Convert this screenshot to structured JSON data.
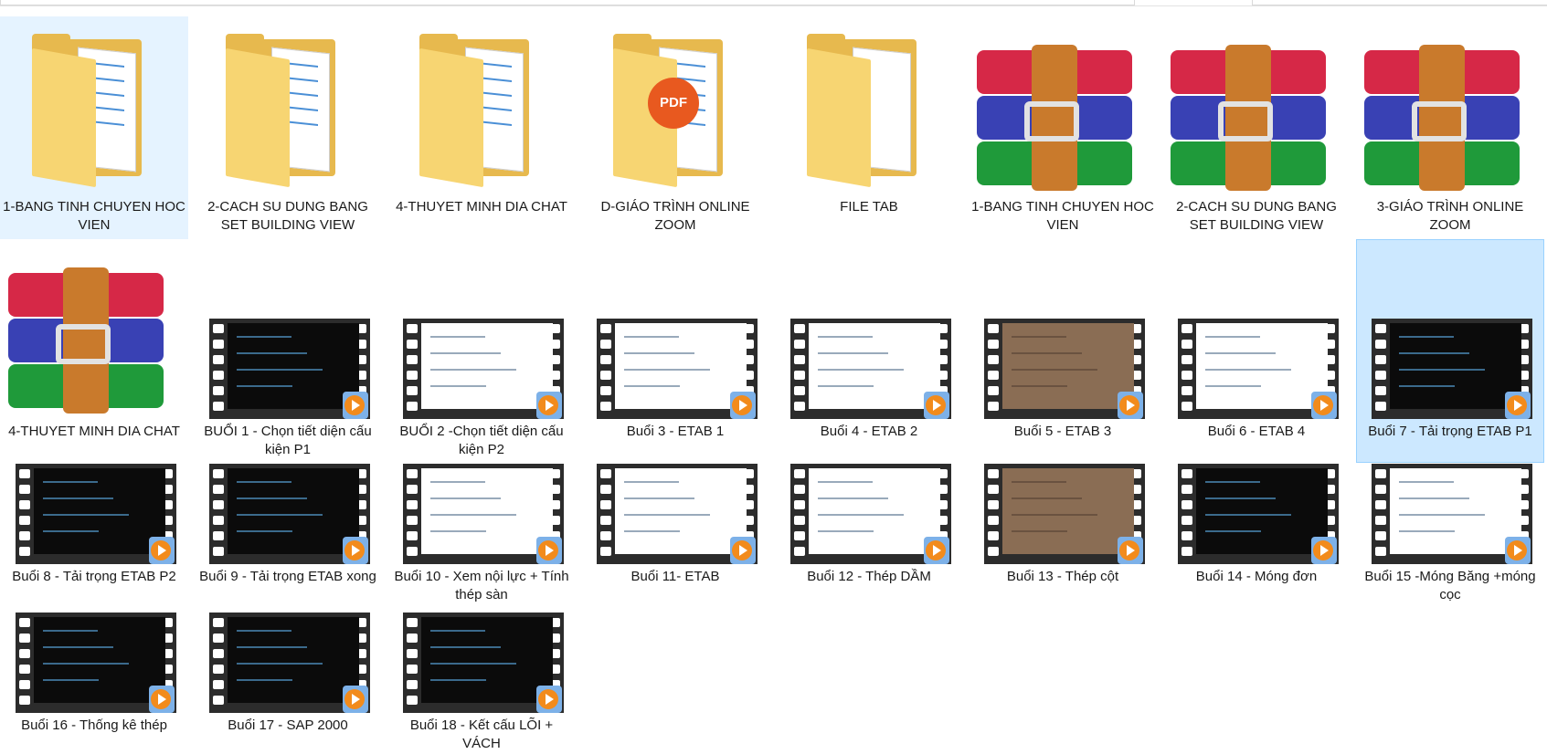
{
  "colors": {
    "selection_fill": "#cce8ff",
    "selection_border": "#99d1ff",
    "folder": "#e7b94e",
    "text": "#1a1a1a"
  },
  "items": [
    {
      "name": "1-BANG TINH CHUYEN HOC VIEN",
      "type": "folder",
      "icon": "folder-icon"
    },
    {
      "name": "2-CACH SU DUNG BANG SET BUILDING VIEW",
      "type": "folder",
      "icon": "folder-icon"
    },
    {
      "name": "4-THUYET MINH DIA CHAT",
      "type": "folder",
      "icon": "folder-icon"
    },
    {
      "name": "D-GIÁO TRÌNH ONLINE ZOOM",
      "type": "folder-pdf",
      "icon": "pdf-folder-icon",
      "badge": "PDF"
    },
    {
      "name": "FILE TAB",
      "type": "folder-empty",
      "icon": "folder-icon"
    },
    {
      "name": "1-BANG TINH CHUYEN HOC VIEN",
      "type": "archive",
      "icon": "winrar-archive-icon"
    },
    {
      "name": "2-CACH SU DUNG BANG SET BUILDING VIEW",
      "type": "archive",
      "icon": "winrar-archive-icon"
    },
    {
      "name": "3-GIÁO TRÌNH ONLINE ZOOM",
      "type": "archive",
      "icon": "winrar-archive-icon"
    },
    {
      "name": "4-THUYET MINH DIA CHAT",
      "type": "archive",
      "icon": "winrar-archive-icon"
    },
    {
      "name": "BUỔI 1 - Chọn tiết diện cấu kiện P1",
      "type": "video",
      "icon": "video-file-icon"
    },
    {
      "name": "BUỔI 2 -Chọn tiết diện cấu kiện P2",
      "type": "video",
      "icon": "video-file-icon"
    },
    {
      "name": "Buổi 3 - ETAB 1",
      "type": "video",
      "icon": "video-file-icon"
    },
    {
      "name": "Buổi 4 - ETAB 2",
      "type": "video",
      "icon": "video-file-icon"
    },
    {
      "name": "Buổi 5 - ETAB 3",
      "type": "video",
      "icon": "video-file-icon"
    },
    {
      "name": "Buổi 6 - ETAB 4",
      "type": "video",
      "icon": "video-file-icon"
    },
    {
      "name": "Buổi 7 - Tải trọng ETAB P1",
      "type": "video",
      "icon": "video-file-icon"
    },
    {
      "name": "Buổi 8 - Tải trọng ETAB P2",
      "type": "video",
      "icon": "video-file-icon"
    },
    {
      "name": "Buổi 9 - Tải trọng ETAB xong",
      "type": "video",
      "icon": "video-file-icon"
    },
    {
      "name": "Buổi 10 - Xem nội lực + Tính thép sàn",
      "type": "video",
      "icon": "video-file-icon"
    },
    {
      "name": "Buổi 11-  ETAB",
      "type": "video",
      "icon": "video-file-icon"
    },
    {
      "name": "Buổi 12 - Thép DẦM",
      "type": "video",
      "icon": "video-file-icon"
    },
    {
      "name": "Buổi 13 - Thép cột",
      "type": "video",
      "icon": "video-file-icon"
    },
    {
      "name": "Buổi 14 - Móng đơn",
      "type": "video",
      "icon": "video-file-icon"
    },
    {
      "name": "Buổi 15 -Móng Băng +móng cọc",
      "type": "video",
      "icon": "video-file-icon"
    },
    {
      "name": "Buổi 16 - Thống kê thép",
      "type": "video",
      "icon": "video-file-icon"
    },
    {
      "name": "Buổi 17 - SAP 2000",
      "type": "video",
      "icon": "video-file-icon"
    },
    {
      "name": "Buổi 18 - Kết cấu LÕI + VÁCH",
      "type": "video",
      "icon": "video-file-icon"
    }
  ]
}
